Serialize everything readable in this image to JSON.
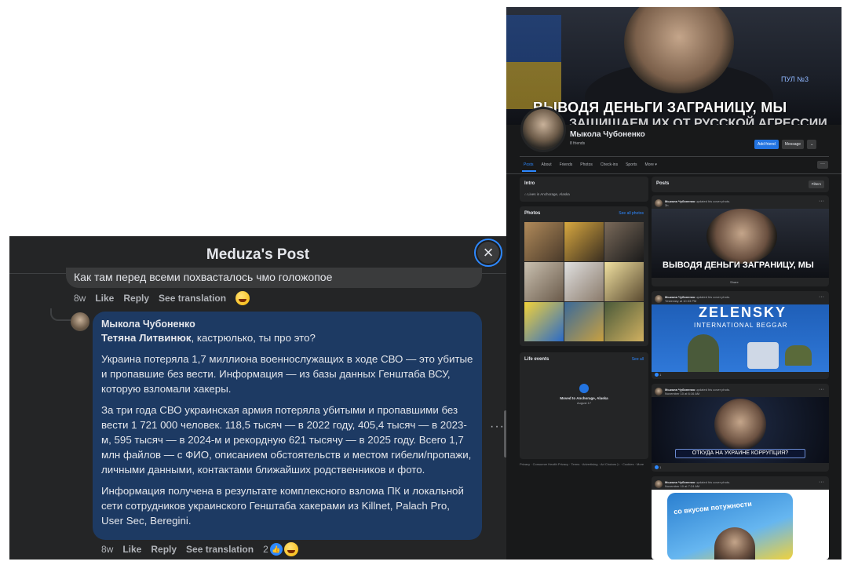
{
  "modal": {
    "title": "Meduza's Post",
    "close_label": "×",
    "previous_comment": {
      "text": "Как там перед всеми похвасталось чмо голожопое",
      "time": "8w",
      "like": "Like",
      "reply": "Reply",
      "translate": "See translation"
    },
    "comment": {
      "author": "Мыкола Чубоненко",
      "mention": "Тетяна Литвинюк",
      "first_line_rest": ", кастрюлько, ты про это?",
      "para1": "Украина потеряла 1,7 миллиона военнослужащих в ходе СВО — это убитые и пропавшие без вести. Информация — из базы данных Генштаба ВСУ, которую взломали хакеры.",
      "para2": "За три года СВО украинская армия потеряла убитыми и пропавшими без вести 1 721 000 человек. 118,5 тысяч — в 2022 году, 405,4 тысяч — в 2023-м, 595 тысяч — в 2024-м и рекордную 621 тысячу — в 2025 году. Всего 1,7 млн файлов — с ФИО, описанием обстоятельств и местом гибели/пропажи, личными данными, контактами ближайших родственников и фото.",
      "para3": "Информация получена в результате комплексного взлома ПК и локальной сети сотрудников украинского Генштаба хакерами из Killnet, Palach Pro, User Sec, Beregini.",
      "time": "8w",
      "like": "Like",
      "reply": "Reply",
      "translate": "See translation",
      "reaction_count": "2",
      "more": "···"
    }
  },
  "profile": {
    "cover_headline": "ВЫВОДЯ ДЕНЬГИ ЗАГРАНИЦУ, МЫ",
    "cover_headline2": "ЗАЩИЩАЕМ ИХ ОТ РУССКОЙ АГРЕССИИ",
    "cover_watermark": "ПУЛ №3",
    "name": "Мыкола Чубоненко",
    "friends": "8 friends",
    "add_friend": "Add friend",
    "message": "Message",
    "chevron": "⌄",
    "tabs": [
      "Posts",
      "About",
      "Friends",
      "Photos",
      "Check-ins",
      "Sports",
      "More ▾"
    ],
    "tab_more": "···",
    "intro": {
      "title": "Intro",
      "lives": "Lives in Anchorage, Alaska"
    },
    "photos": {
      "title": "Photos",
      "see_all": "See all photos"
    },
    "life_events": {
      "title": "Life events",
      "see_all": "See all",
      "event": "Moved to Anchorage, Alaska",
      "date": "August 17"
    },
    "footer": "Privacy · Consumer Health Privacy · Terms · Advertising · Ad Choices ▷ · Cookies · More",
    "posts": {
      "title": "Posts",
      "filters": "Filters",
      "items": [
        {
          "author": "Мыкола Чубоненко",
          "action": "updated his cover photo.",
          "time": "3h",
          "image_text": "ВЫВОДЯ ДЕНЬГИ ЗАГРАНИЦУ, МЫ",
          "footer": "Share"
        },
        {
          "author": "Мыкола Чубоненко",
          "action": "updated his cover photo.",
          "time": "Yesterday at 10:33 PM",
          "image_text": "ZELENSKY",
          "image_sub": "INTERNATIONAL BEGGAR",
          "footer": "1"
        },
        {
          "author": "Мыкола Чубоненко",
          "action": "updated his cover photo.",
          "time": "November 10 at 6:16 AM",
          "image_text": "ОТКУДА НА УКРАИНЕ КОРРУПЦИЯ?",
          "footer": "1"
        },
        {
          "author": "Мыкола Чубоненко",
          "action": "updated his cover photo.",
          "time": "November 10 at 7:24 AM",
          "image_text": "со вкусом потужности"
        }
      ]
    }
  }
}
